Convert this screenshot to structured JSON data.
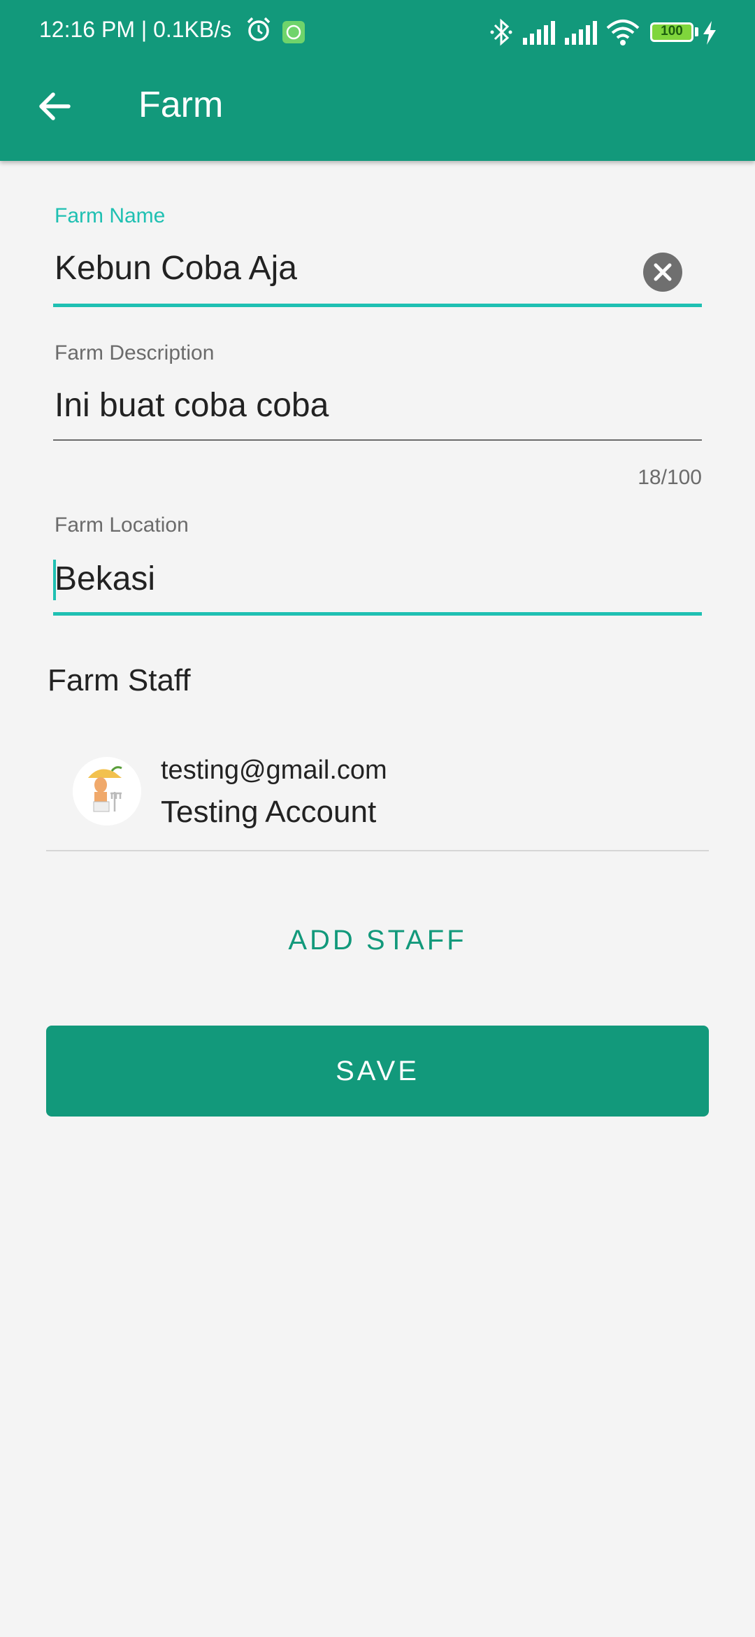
{
  "status_bar": {
    "time_speed": "12:16 PM | 0.1KB/s",
    "battery": "100",
    "icons": [
      "alarm-icon",
      "whatsapp-icon",
      "bluetooth-icon",
      "signal-icon",
      "signal-icon",
      "wifi-icon",
      "battery-icon",
      "charging-icon"
    ]
  },
  "app_bar": {
    "title": "Farm",
    "back_icon": "arrow-back-icon"
  },
  "form": {
    "farm_name": {
      "label": "Farm Name",
      "value": "Kebun Coba Aja"
    },
    "farm_description": {
      "label": "Farm Description",
      "value": "Ini buat coba coba",
      "counter": "18/100"
    },
    "farm_location": {
      "label": "Farm Location",
      "value": "Bekasi"
    }
  },
  "staff": {
    "section_title": "Farm Staff",
    "items": [
      {
        "email": "testing@gmail.com",
        "name": "Testing Account"
      }
    ],
    "add_label": "ADD STAFF"
  },
  "actions": {
    "save_label": "SAVE"
  },
  "colors": {
    "primary": "#12997b",
    "accent": "#1fc0b2",
    "background": "#f4f4f4"
  }
}
